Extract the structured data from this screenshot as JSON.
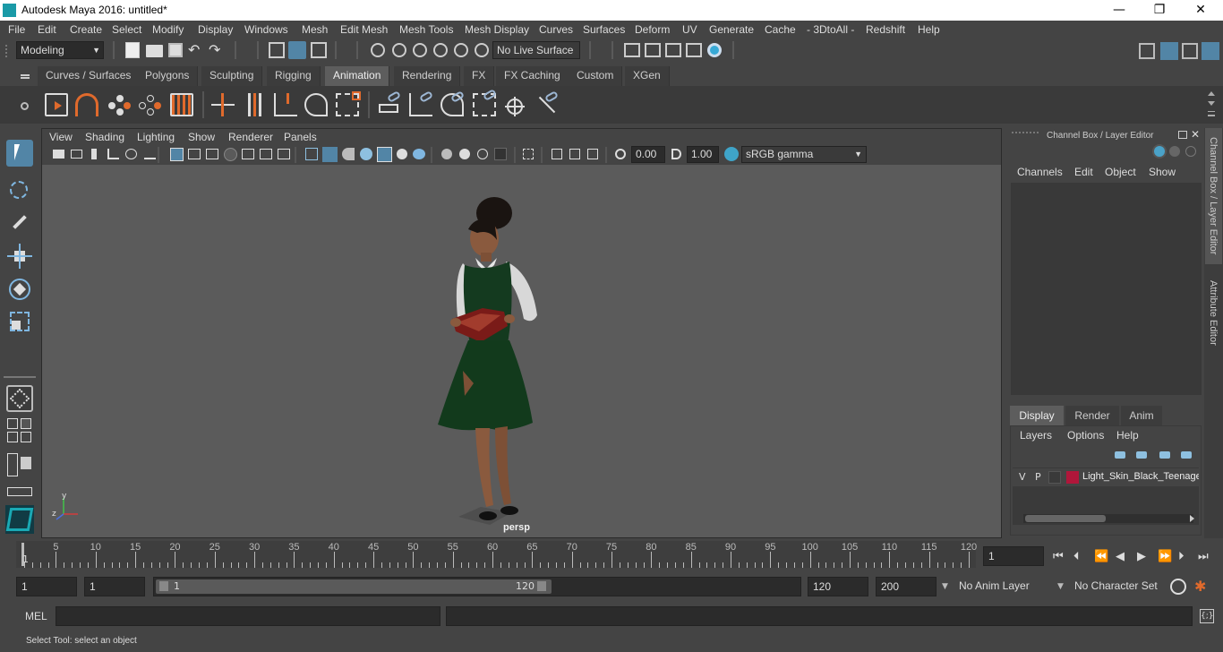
{
  "window": {
    "title": "Autodesk Maya 2016: untitled*",
    "minimize": "—",
    "maximize": "❐",
    "close": "✕"
  },
  "menu": [
    "File",
    "Edit",
    "Create",
    "Select",
    "Modify",
    "Display",
    "Windows",
    "Mesh",
    "Edit Mesh",
    "Mesh Tools",
    "Mesh Display",
    "Curves",
    "Surfaces",
    "Deform",
    "UV",
    "Generate",
    "Cache",
    "- 3DtoAll -",
    "Redshift",
    "Help"
  ],
  "status_line": {
    "mode": "Modeling",
    "live_surface": "No Live Surface"
  },
  "shelf_tabs": [
    "Curves / Surfaces",
    "Polygons",
    "Sculpting",
    "Rigging",
    "Animation",
    "Rendering",
    "FX",
    "FX Caching",
    "Custom",
    "XGen"
  ],
  "active_shelf_tab": "Animation",
  "viewport": {
    "menu": [
      "View",
      "Shading",
      "Lighting",
      "Show",
      "Renderer",
      "Panels"
    ],
    "exposure": "0.00",
    "gamma": "1.00",
    "color_space": "sRGB gamma",
    "camera_label": "persp",
    "axis_y": "y",
    "axis_z": "z"
  },
  "channel_box": {
    "title": "Channel Box / Layer Editor",
    "menu": [
      "Channels",
      "Edit",
      "Object",
      "Show"
    ],
    "layer_tabs": [
      "Display",
      "Render",
      "Anim"
    ],
    "layer_menu": [
      "Layers",
      "Options",
      "Help"
    ],
    "layer": {
      "v": "V",
      "p": "P",
      "name": "Light_Skin_Black_Teenage",
      "color": "#b0163a"
    }
  },
  "side_tabs": [
    "Channel Box / Layer Editor",
    "Attribute Editor"
  ],
  "time_slider": {
    "ticks": [
      5,
      10,
      15,
      20,
      25,
      30,
      35,
      40,
      45,
      50,
      55,
      60,
      65,
      70,
      75,
      80,
      85,
      90,
      95,
      100,
      105,
      110,
      115,
      120
    ],
    "current_marker": "1",
    "current_frame": "1"
  },
  "range_slider": {
    "start": "1",
    "playback_start": "1",
    "range_start": "1",
    "range_end": "120",
    "playback_end": "120",
    "end": "200",
    "anim_layer": "No Anim Layer",
    "character_set": "No Character Set"
  },
  "command_line": {
    "label": "MEL"
  },
  "help_line": "Select Tool: select an object"
}
